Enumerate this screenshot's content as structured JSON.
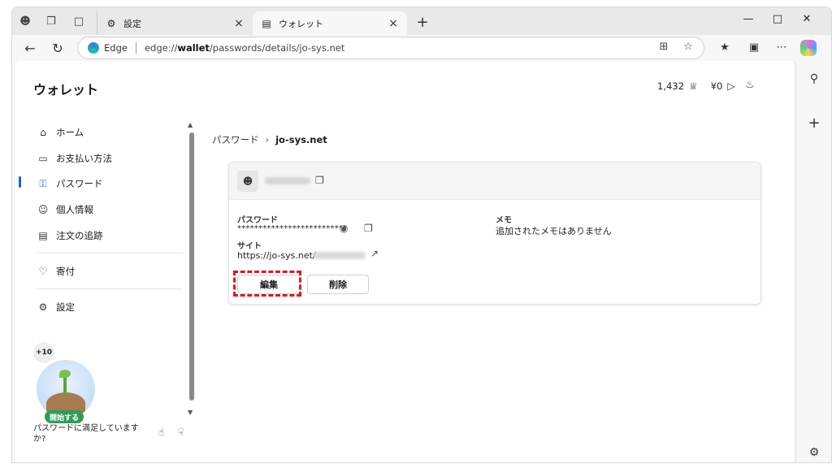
{
  "browser": {
    "tabs": [
      {
        "title": "設定",
        "icon": "gear-icon"
      },
      {
        "title": "ウォレット",
        "icon": "wallet-icon"
      }
    ],
    "address": {
      "brand": "Edge",
      "url_prefix": "edge://",
      "url_bold": "wallet",
      "url_rest": "/passwords/details/jo-sys.net"
    }
  },
  "wallet": {
    "title": "ウォレット",
    "points": "1,432",
    "cash": "¥0"
  },
  "nav": {
    "items": [
      {
        "label": "ホーム",
        "icon": "home-icon"
      },
      {
        "label": "お支払い方法",
        "icon": "card-icon"
      },
      {
        "label": "パスワード",
        "icon": "key-icon"
      },
      {
        "label": "個人情報",
        "icon": "person-icon"
      },
      {
        "label": "注文の追跡",
        "icon": "receipt-icon"
      },
      {
        "label": "寄付",
        "icon": "heart-icon"
      },
      {
        "label": "設定",
        "icon": "gear-icon"
      }
    ],
    "active_index": 2
  },
  "promo": {
    "badge": "+10",
    "start_label": "開始する",
    "survey_text": "パスワードに満足していますか?"
  },
  "breadcrumb": {
    "root": "パスワード",
    "current": "jo-sys.net"
  },
  "details": {
    "password_label": "パスワード",
    "password_value": "**************************",
    "site_label": "サイト",
    "site_value": "https://jo-sys.net/",
    "memo_label": "メモ",
    "memo_value": "追加されたメモはありません",
    "edit_label": "編集",
    "delete_label": "削除"
  },
  "colors": {
    "accent": "#1a63c6",
    "highlight": "#e3141e",
    "start_button": "#2e9c5a"
  }
}
